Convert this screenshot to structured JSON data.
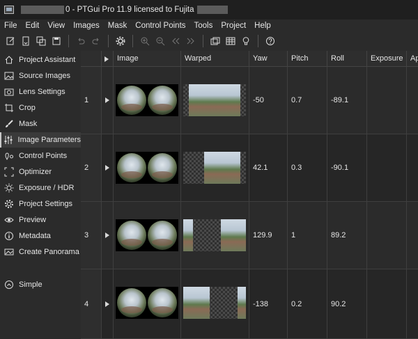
{
  "window": {
    "title": "0 - PTGui Pro 11.9 licensed to Fujita"
  },
  "menu": [
    "File",
    "Edit",
    "View",
    "Images",
    "Mask",
    "Control Points",
    "Tools",
    "Project",
    "Help"
  ],
  "toolbar": {
    "icons": [
      "new-project-icon",
      "open-project-icon",
      "save-as-icon",
      "save-icon",
      "undo-icon",
      "redo-icon",
      "settings-icon",
      "zoom-in-icon",
      "zoom-out-icon",
      "previous-icon",
      "next-icon",
      "panorama-editor-icon",
      "table-icon",
      "lightbulb-icon",
      "help-icon"
    ]
  },
  "sidebar": {
    "items": [
      {
        "label": "Project Assistant",
        "icon": "home-icon"
      },
      {
        "label": "Source Images",
        "icon": "image-icon"
      },
      {
        "label": "Lens Settings",
        "icon": "camera-icon"
      },
      {
        "label": "Crop",
        "icon": "crop-icon"
      },
      {
        "label": "Mask",
        "icon": "mask-brush-icon"
      },
      {
        "label": "Image Parameters",
        "icon": "sliders-icon",
        "active": true
      },
      {
        "label": "Control Points",
        "icon": "control-points-icon"
      },
      {
        "label": "Optimizer",
        "icon": "optimizer-icon"
      },
      {
        "label": "Exposure / HDR",
        "icon": "sun-icon"
      },
      {
        "label": "Project Settings",
        "icon": "gear-icon"
      },
      {
        "label": "Preview",
        "icon": "eye-icon"
      },
      {
        "label": "Metadata",
        "icon": "info-icon"
      },
      {
        "label": "Create Panorama",
        "icon": "panorama-icon"
      }
    ],
    "simple_label": "Simple"
  },
  "table": {
    "headers": [
      "Image",
      "Warped",
      "Yaw",
      "Pitch",
      "Roll",
      "Exposure",
      "Ap"
    ],
    "rows": [
      {
        "num": "1",
        "yaw": "-50",
        "pitch": "0.7",
        "roll": "-89.1"
      },
      {
        "num": "2",
        "yaw": "42.1",
        "pitch": "0.3",
        "roll": "-90.1"
      },
      {
        "num": "3",
        "yaw": "129.9",
        "pitch": "1",
        "roll": "89.2"
      },
      {
        "num": "4",
        "yaw": "-138",
        "pitch": "0.2",
        "roll": "90.2"
      }
    ]
  }
}
